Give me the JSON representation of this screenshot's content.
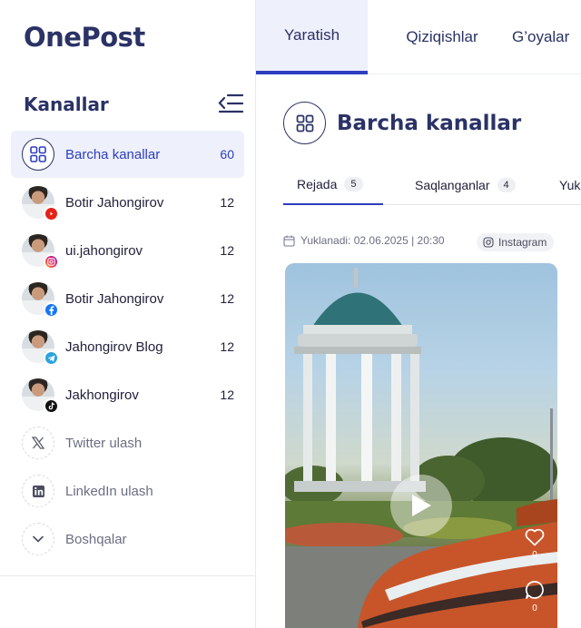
{
  "app": {
    "logo": "OnePost"
  },
  "sidebar": {
    "title": "Kanallar",
    "items": [
      {
        "label": "Barcha kanallar",
        "count": "60",
        "icon": "grid-icon"
      },
      {
        "label": "Botir Jahongirov",
        "count": "12",
        "icon": "youtube-icon"
      },
      {
        "label": "ui.jahongirov",
        "count": "12",
        "icon": "instagram-icon"
      },
      {
        "label": "Botir Jahongirov",
        "count": "12",
        "icon": "facebook-icon"
      },
      {
        "label": "Jahongirov Blog",
        "count": "12",
        "icon": "telegram-icon"
      },
      {
        "label": "Jakhongirov",
        "count": "12",
        "icon": "tiktok-icon"
      },
      {
        "label": "Twitter ulash",
        "icon": "x-icon"
      },
      {
        "label": "LinkedIn ulash",
        "icon": "linkedin-icon"
      },
      {
        "label": "Boshqalar",
        "icon": "chevron-down-icon"
      }
    ]
  },
  "topbar": {
    "tabs": [
      {
        "label": "Yaratish"
      },
      {
        "label": "Qiziqishlar"
      },
      {
        "label": "G’oyalar"
      }
    ]
  },
  "main": {
    "title": "Barcha kanallar",
    "subtabs": [
      {
        "label": "Rejada",
        "count": "5"
      },
      {
        "label": "Saqlanganlar",
        "count": "4"
      },
      {
        "label": "Yuk"
      }
    ],
    "post": {
      "uploaded": "Yuklanadi: 02.06.2025 | 20:30",
      "platform": "Instagram",
      "likes": "0",
      "comments": "0"
    }
  },
  "colors": {
    "accent": "#2d3ec0",
    "navy": "#2a3266",
    "active_bg": "#eef0fb"
  }
}
